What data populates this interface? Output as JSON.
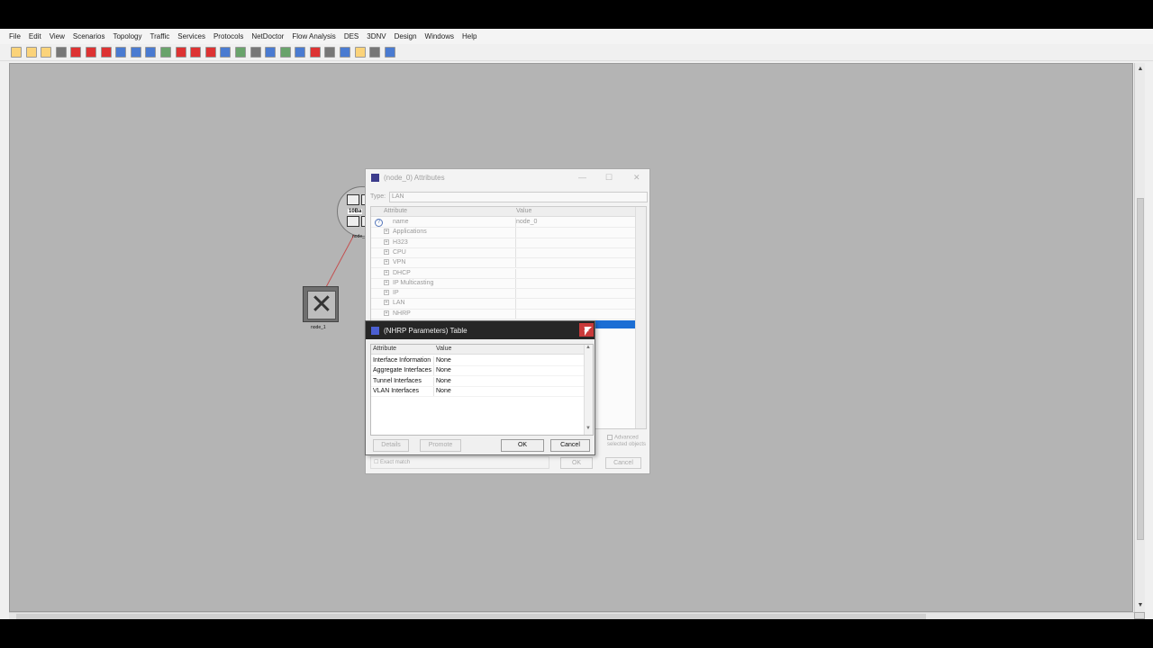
{
  "menu": [
    "File",
    "Edit",
    "View",
    "Scenarios",
    "Topology",
    "Traffic",
    "Services",
    "Protocols",
    "NetDoctor",
    "Flow Analysis",
    "DES",
    "3DNV",
    "Design",
    "Windows",
    "Help"
  ],
  "toolbar_icons": [
    "new-project-icon",
    "open-icon",
    "save-icon",
    "print-icon",
    "object-palette-icon",
    "node-model-icon",
    "link-icon",
    "failure-icon",
    "zoom-in-icon",
    "zoom-out-icon",
    "configure-icon",
    "traffic-icon",
    "filter-icon",
    "stop-icon",
    "devices-icon",
    "reports-icon",
    "results-icon",
    "grid-icon",
    "run-icon",
    "view-results-icon",
    "statistics-icon",
    "spreadsheet-icon",
    "edit-icon",
    "annotation-icon",
    "packet-icon",
    "export-icon"
  ],
  "canvas": {
    "hub_label": "10Ba",
    "node_0_label": "node_0",
    "node_1_label": "node_1"
  },
  "attributes_dialog": {
    "title": "(node_0) Attributes",
    "type_label": "Type:",
    "type_value": "LAN",
    "col_attribute": "Attribute",
    "col_value": "Value",
    "rows": [
      {
        "name": "name",
        "value": "node_0",
        "expandable": false
      },
      {
        "name": "Applications",
        "value": "",
        "expandable": true
      },
      {
        "name": "H323",
        "value": "",
        "expandable": true
      },
      {
        "name": "CPU",
        "value": "",
        "expandable": true
      },
      {
        "name": "VPN",
        "value": "",
        "expandable": true
      },
      {
        "name": "DHCP",
        "value": "",
        "expandable": true
      },
      {
        "name": "IP Multicasting",
        "value": "",
        "expandable": true
      },
      {
        "name": "IP",
        "value": "",
        "expandable": true
      },
      {
        "name": "LAN",
        "value": "",
        "expandable": true
      },
      {
        "name": "NHRP",
        "value": "",
        "expandable": true
      }
    ],
    "advanced_label": "Advanced",
    "apply_label": "selected objects",
    "exact_match_label": "Exact match",
    "ok": "OK",
    "cancel": "Cancel"
  },
  "nhrp_dialog": {
    "title": "(NHRP Parameters) Table",
    "col_attribute": "Attribute",
    "col_value": "Value",
    "rows": [
      {
        "name": "Interface Information",
        "value": "None"
      },
      {
        "name": "Aggregate Interfaces",
        "value": "None"
      },
      {
        "name": "Tunnel Interfaces",
        "value": "None"
      },
      {
        "name": "VLAN Interfaces",
        "value": "None"
      }
    ],
    "details": "Details",
    "promote": "Promote",
    "ok": "OK",
    "cancel": "Cancel"
  },
  "colors": {
    "canvas_bg": "#b4b4b4",
    "title_dark": "#262626",
    "close_red": "#c93a3a",
    "selection_blue": "#1b6ed4"
  }
}
